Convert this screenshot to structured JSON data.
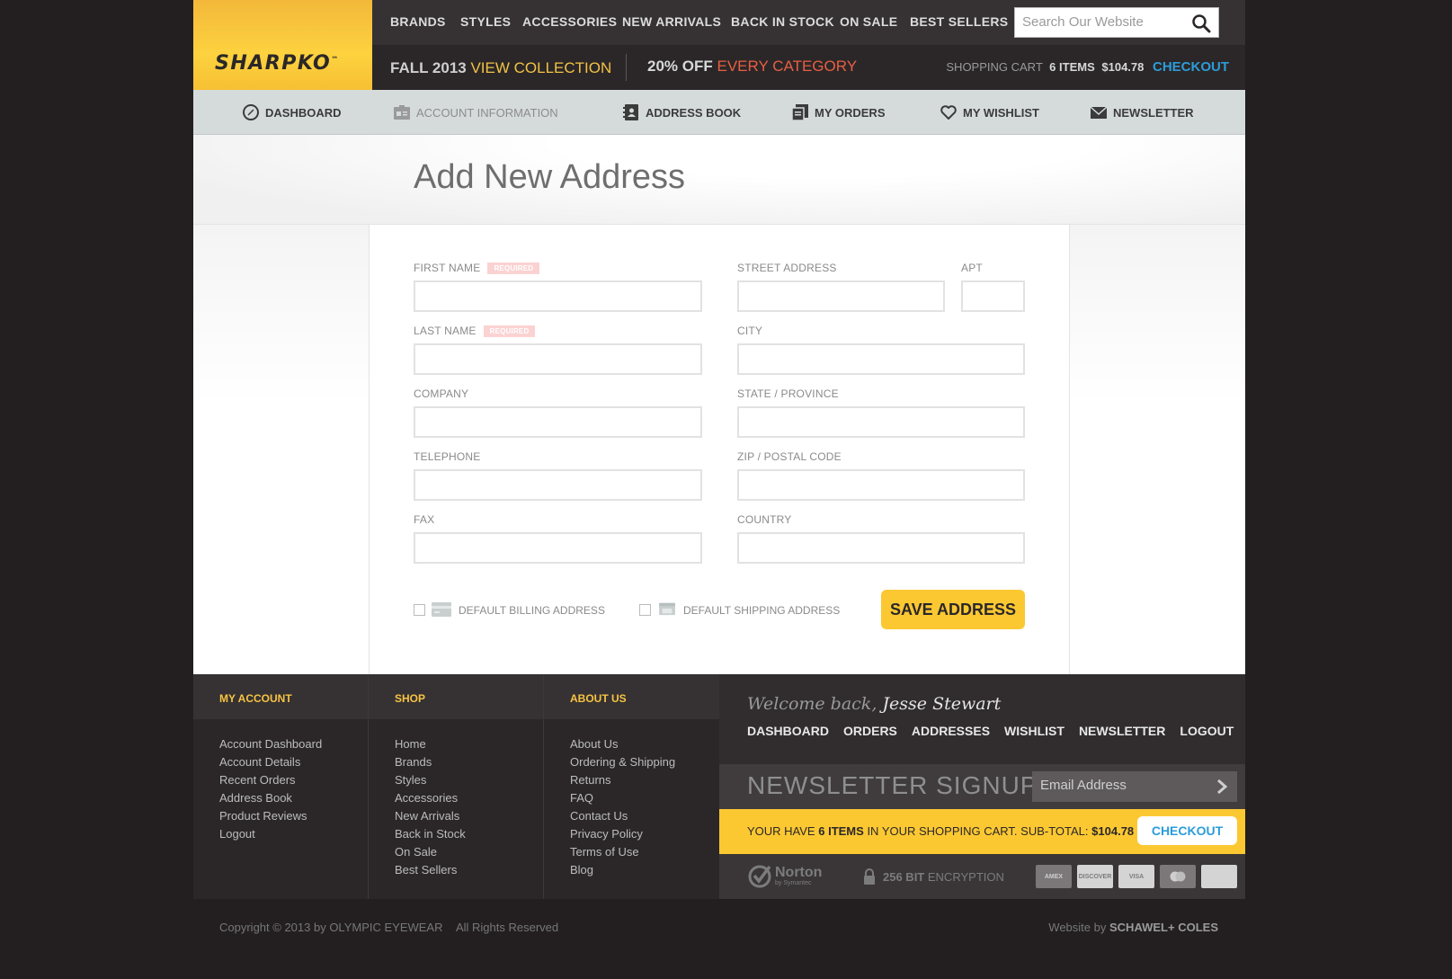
{
  "brand": {
    "logo": "SHARPKO",
    "logo_mark": "™"
  },
  "topnav": {
    "items": [
      "BRANDS",
      "STYLES",
      "ACCESSORIES",
      "NEW ARRIVALS",
      "BACK IN STOCK",
      "ON SALE",
      "BEST SELLERS"
    ],
    "search_placeholder": "Search Our Website"
  },
  "promo": {
    "season": "FALL 2013",
    "season_link": "VIEW COLLECTION",
    "discount": "20% OFF",
    "discount_text": "EVERY CATEGORY"
  },
  "cart": {
    "label": "SHOPPING CART",
    "items": "6 ITEMS",
    "total": "$104.78",
    "checkout": "CHECKOUT"
  },
  "account_nav": [
    "DASHBOARD",
    "ACCOUNT INFORMATION",
    "ADDRESS BOOK",
    "MY ORDERS",
    "MY WISHLIST",
    "NEWSLETTER"
  ],
  "page": {
    "title": "Add New Address"
  },
  "form": {
    "required_badge": "REQUIRED",
    "labels": {
      "first_name": "FIRST NAME",
      "last_name": "LAST NAME",
      "company": "COMPANY",
      "telephone": "TELEPHONE",
      "fax": "FAX",
      "street": "STREET ADDRESS",
      "apt": "APT",
      "city": "CITY",
      "state": "STATE / PROVINCE",
      "zip": "ZIP / POSTAL CODE",
      "country": "COUNTRY"
    },
    "default_billing": "DEFAULT BILLING ADDRESS",
    "default_shipping": "DEFAULT SHIPPING ADDRESS",
    "save": "SAVE ADDRESS"
  },
  "footer": {
    "my_account": {
      "title": "MY ACCOUNT",
      "links": [
        "Account Dashboard",
        "Account Details",
        "Recent Orders",
        "Address Book",
        "Product Reviews",
        "Logout"
      ]
    },
    "shop": {
      "title": "SHOP",
      "links": [
        "Home",
        "Brands",
        "Styles",
        "Accessories",
        "New Arrivals",
        "Back in Stock",
        "On Sale",
        "Best Sellers"
      ]
    },
    "about": {
      "title": "ABOUT US",
      "links": [
        "About Us",
        "Ordering & Shipping",
        "Returns",
        "FAQ",
        "Contact Us",
        "Privacy Policy",
        "Terms of Use",
        "Blog"
      ]
    },
    "welcome_prefix": "Welcome back,",
    "user_name": "Jesse Stewart",
    "user_links": [
      "DASHBOARD",
      "ORDERS",
      "ADDRESSES",
      "WISHLIST",
      "NEWSLETTER",
      "LOGOUT"
    ],
    "newsletter_title": "NEWSLETTER SIGNUP",
    "email_placeholder": "Email Address",
    "cart_prefix": "YOUR HAVE",
    "cart_items": "6 ITEMS",
    "cart_mid": "IN YOUR SHOPPING CART. SUB-TOTAL:",
    "cart_total": "$104.78",
    "checkout": "CHECKOUT",
    "norton": "Norton",
    "norton_sub": "by Symantec",
    "encryption_bold": "256 BIT",
    "encryption_text": "ENCRYPTION",
    "cards": [
      "AMEX",
      "DISCOVER",
      "VISA",
      "",
      ""
    ]
  },
  "bottom": {
    "copyright": "Copyright © 2013 by OLYMPIC EYEWEAR",
    "rights": "All Rights Reserved",
    "credit_prefix": "Website by",
    "credit_name": "SCHAWEL+ COLES"
  },
  "colors": {
    "accent": "#fcc832",
    "link_blue": "#2c9cd9",
    "required": "#fbd2d2",
    "background": "#231f20"
  }
}
